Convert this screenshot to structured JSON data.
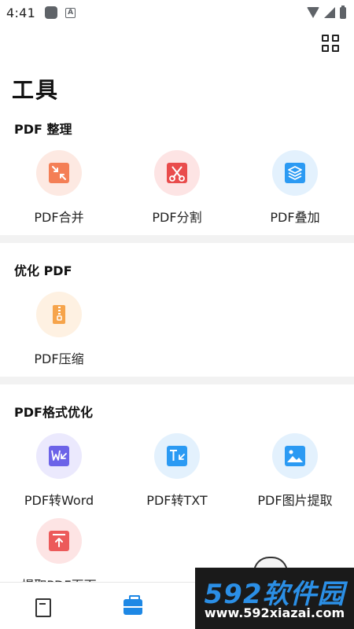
{
  "status_bar": {
    "time": "4:41",
    "a_badge": "A"
  },
  "header": {
    "title": "工具"
  },
  "sections": [
    {
      "title": "PDF 整理",
      "tools": [
        {
          "label": "PDF合并",
          "icon": "merge-icon"
        },
        {
          "label": "PDF分割",
          "icon": "scissors-icon"
        },
        {
          "label": "PDF叠加",
          "icon": "layers-icon"
        }
      ]
    },
    {
      "title": "优化 PDF",
      "tools": [
        {
          "label": "PDF压缩",
          "icon": "zip-icon"
        }
      ]
    },
    {
      "title": "PDF格式优化",
      "tools": [
        {
          "label": "PDF转Word",
          "icon": "word-icon"
        },
        {
          "label": "PDF转TXT",
          "icon": "txt-icon"
        },
        {
          "label": "PDF图片提取",
          "icon": "image-icon"
        },
        {
          "label": "提取PDF页面",
          "icon": "extract-page-icon"
        }
      ]
    }
  ],
  "colors": {
    "merge": "#f47f56",
    "scissors": "#e94c4c",
    "layers": "#2b9af3",
    "zip": "#f6a44b",
    "word": "#6c63e8",
    "txt": "#2b9af3",
    "image": "#2b9af3",
    "extract": "#ec5a5a",
    "nav_active": "#1e88e5"
  },
  "watermark": {
    "brand": "592软件园",
    "url": "www.592xiazai.com"
  }
}
